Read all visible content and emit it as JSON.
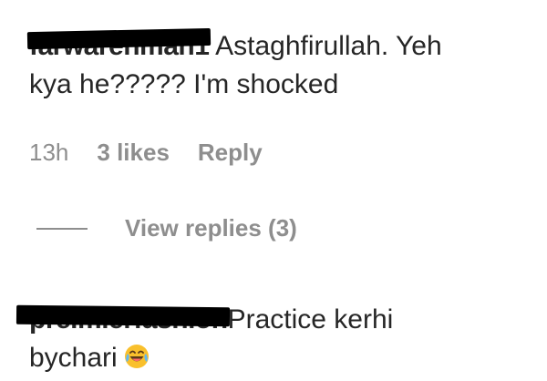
{
  "comments": [
    {
      "username": "farwarehman1",
      "text_line1": "Astaghfirullah. Yeh",
      "text_line2": "kya he????? I'm shocked",
      "time": "13h",
      "likes": "3 likes",
      "reply_label": "Reply",
      "view_replies_label": "View replies (3)"
    },
    {
      "username": "preimierfashion",
      "text_line1": "Practice kerhi",
      "text_line2": "bychari",
      "emoji": "laughing-tears-emoji"
    }
  ],
  "colors": {
    "text": "#262626",
    "muted": "#8e8e8e",
    "redaction": "#000000",
    "emoji_face": "#f9c02c"
  }
}
